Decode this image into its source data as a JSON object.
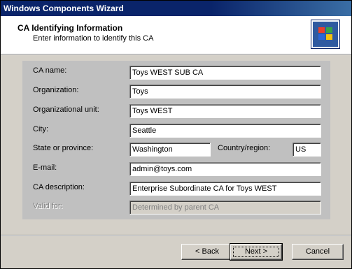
{
  "window": {
    "title": "Windows Components Wizard"
  },
  "header": {
    "title": "CA Identifying Information",
    "subtitle": "Enter information to identify this CA",
    "icon": "windows-logo-icon"
  },
  "form": {
    "ca_name": {
      "label": "CA name:",
      "value": "Toys WEST SUB CA"
    },
    "organization": {
      "label": "Organization:",
      "value": "Toys"
    },
    "org_unit": {
      "label": "Organizational unit:",
      "value": "Toys WEST"
    },
    "city": {
      "label": "City:",
      "value": "Seattle"
    },
    "state": {
      "label": "State or province:",
      "value": "Washington"
    },
    "country": {
      "label": "Country/region:",
      "value": "US"
    },
    "email": {
      "label": "E-mail:",
      "value": "admin@toys.com"
    },
    "description": {
      "label": "CA description:",
      "value": "Enterprise Subordinate CA for Toys WEST"
    },
    "valid_for": {
      "label": "Valid for:",
      "value": "Determined by parent CA"
    }
  },
  "buttons": {
    "back": "< Back",
    "next": "Next >",
    "cancel": "Cancel"
  },
  "colors": {
    "titlebar": "#0a246a",
    "face": "#d4d0c8",
    "panel": "#c0c0c0"
  }
}
